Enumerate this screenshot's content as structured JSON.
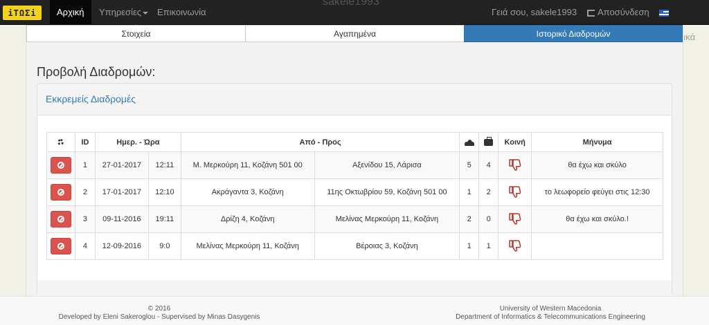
{
  "navbar": {
    "brand": "iTΩΣi",
    "home": "Αρχική",
    "services": "Υπηρεσίες",
    "contact": "Επικοινωνία",
    "ghost_title": "sakele1993",
    "greeting": "Γειά σου, sakele1993",
    "logout": "Αποσύνδεση",
    "language": "Ελληνικά"
  },
  "tabs": [
    "Στοιχεία",
    "Αγαπημένα",
    "Ιστορικό Διαδρομών"
  ],
  "page_title": "Προβολή Διαδρομών:",
  "panel_title": "Εκκρεμείς Διαδρομές",
  "table": {
    "headers": {
      "id": "ID",
      "datetime": "Ημερ. - Ώρα",
      "fromto": "Από - Προς",
      "shared": "Κοινή",
      "message": "Μήνυμα"
    },
    "rows": [
      {
        "id": "1",
        "date": "27-01-2017",
        "time": "12:11",
        "from": "Μ. Μερκούρη 11, Κοζάνη 501 00",
        "to": "Αξενίδου 15, Λάρισα",
        "passengers": "5",
        "luggage": "4",
        "message": "θα έχω και σκύλο"
      },
      {
        "id": "2",
        "date": "17-01-2017",
        "time": "12:10",
        "from": "Ακράγαντα 3, Κοζάνη",
        "to": "11ης Οκτωβρίου 59, Κοζάνη 501 00",
        "passengers": "1",
        "luggage": "2",
        "message": "το λεωφορείο φεύγει στις 12:30"
      },
      {
        "id": "3",
        "date": "09-11-2016",
        "time": "19:11",
        "from": "Δρίζη 4, Κοζάνη",
        "to": "Μελίνας Μερκούρη 11, Κοζάνη",
        "passengers": "2",
        "luggage": "0",
        "message": "θα έχω και σκύλο.!"
      },
      {
        "id": "4",
        "date": "12-09-2016",
        "time": "9:0",
        "from": "Μελίνας Μερκούρη 11, Κοζάνη",
        "to": "Βέροιας 3, Κοζάνη",
        "passengers": "1",
        "luggage": "1",
        "message": ""
      }
    ]
  },
  "footer": {
    "copyright": "© 2016",
    "developed": "Developed by Eleni Sakeroglou - Supervised by Minas Dasygenis",
    "university": "University of Western Macedonia",
    "department": "Department of Informatics & Telecommunications Engineering"
  },
  "colors": {
    "primary": "#337ab7",
    "danger": "#d9534f",
    "navbar": "#222222",
    "brand": "#f3d21b",
    "thumb": "#b5332e"
  },
  "icons": {
    "settings_header": "gear-icon",
    "passengers_header": "users-icon",
    "luggage_header": "briefcase-icon",
    "shared_cell": "thumbs-down-icon",
    "delete_button": "ban-icon"
  }
}
